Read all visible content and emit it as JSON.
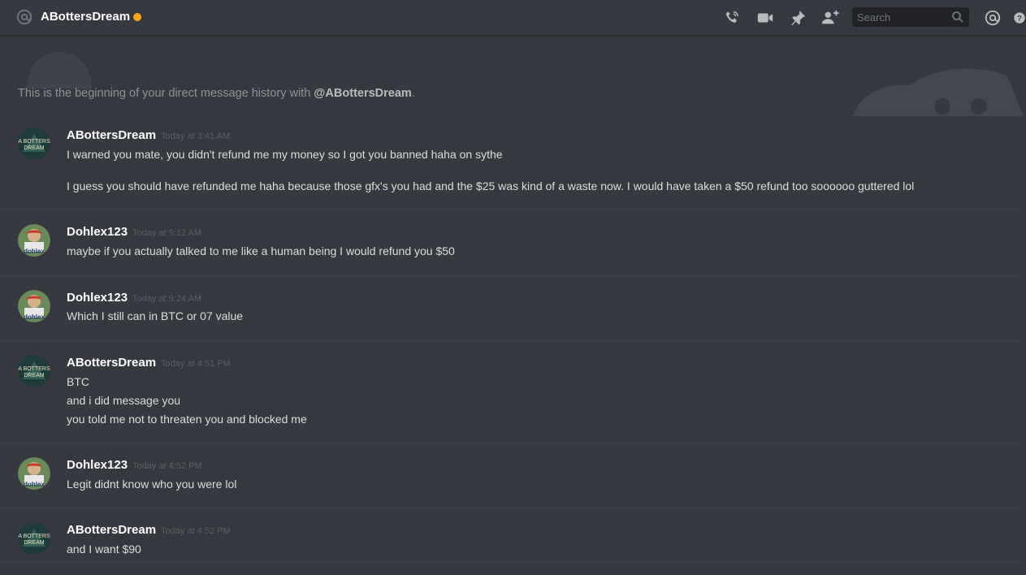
{
  "header": {
    "channel_name": "ABottersDream",
    "status_color": "#faa61a",
    "icons": [
      "phone-call-icon",
      "video-call-icon",
      "pin-icon",
      "add-friend-icon",
      "mention-icon",
      "help-icon"
    ],
    "search_placeholder": "Search"
  },
  "intro": {
    "prefix": "This is the beginning of your direct message history with ",
    "handle": "@ABottersDream",
    "suffix": "."
  },
  "messages": [
    {
      "author": "ABottersDream",
      "timestamp": "Today at 3:41 AM",
      "lines": [
        "I warned you mate, you didn't refund me my money so I got you banned haha on sythe",
        "I guess you should have refunded me haha because those gfx's you had and the $25 was kind of a waste now. I would have taken a $50 refund too soooooo guttered lol"
      ]
    },
    {
      "author": "Dohlex123",
      "timestamp": "Today at 9:12 AM",
      "lines": [
        "maybe if you actually talked to me like a human being I would refund you $50"
      ]
    },
    {
      "author": "Dohlex123",
      "timestamp": "Today at 9:24 AM",
      "lines": [
        "Which I still can in BTC or 07 value"
      ]
    },
    {
      "author": "ABottersDream",
      "timestamp": "Today at 4:51 PM",
      "lines": [
        "BTC",
        "and i did message you",
        "you told me not to threaten you and blocked me"
      ]
    },
    {
      "author": "Dohlex123",
      "timestamp": "Today at 4:52 PM",
      "lines": [
        "Legit didnt know who you were lol"
      ]
    },
    {
      "author": "ABottersDream",
      "timestamp": "Today at 4:52 PM",
      "lines": [
        "and I want $90"
      ]
    }
  ],
  "avatars": {
    "ABottersDream": {
      "text": "A BOTTERS DREAM",
      "bg": "#1f3b3a"
    },
    "Dohlex123": {
      "text": "dohlex",
      "bg": "#8a6a4a"
    }
  }
}
